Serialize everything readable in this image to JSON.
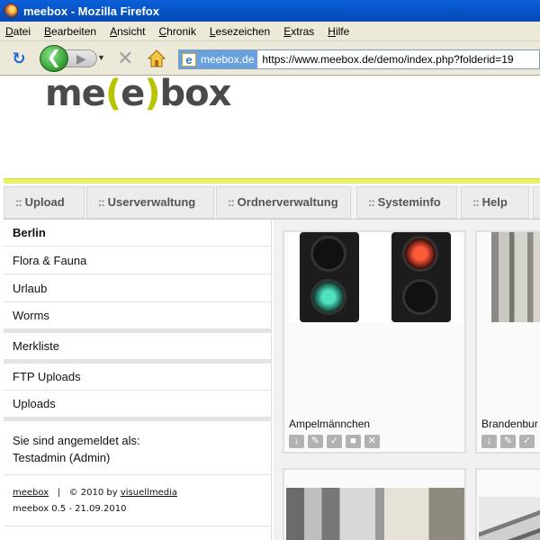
{
  "browser": {
    "title": "meebox - Mozilla Firefox",
    "menu": [
      "Datei",
      "Bearbeiten",
      "Ansicht",
      "Chronik",
      "Lesezeichen",
      "Extras",
      "Hilfe"
    ],
    "site_identity": "meebox.de",
    "url": "https://www.meebox.de/demo/index.php?folderid=19",
    "site_identity_icon": "e"
  },
  "logo": {
    "part1": "me",
    "bracket_open": "(",
    "part2": "e",
    "bracket_close": ")",
    "part3": "box"
  },
  "tabs": [
    {
      "label": "Upload"
    },
    {
      "label": "Userverwaltung"
    },
    {
      "label": "Ordnerverwaltung"
    },
    {
      "label": "Systeminfo"
    },
    {
      "label": "Help"
    }
  ],
  "tab_prefix": "::",
  "sidebar": {
    "folders": [
      "Berlin",
      "Flora & Fauna",
      "Urlaub",
      "Worms"
    ],
    "active_folder": "Berlin",
    "merkliste": "Merkliste",
    "uploads": [
      "FTP Uploads",
      "Uploads"
    ],
    "logged_in_label": "Sie sind angemeldet als:",
    "logged_in_user": "Testadmin (Admin)",
    "footer_brand": "meebox",
    "footer_sep": "|",
    "footer_copy": "© 2010 by",
    "footer_company": "visuellmedia",
    "version": "meebox 0.5 - 21.09.2010"
  },
  "gallery": [
    {
      "title": "Ampelmännchen",
      "actions": [
        "download-icon",
        "edit-icon",
        "check-icon",
        "lock-icon",
        "delete-icon"
      ]
    },
    {
      "title": "Brandenbur",
      "actions": [
        "download-icon",
        "edit-icon",
        "check-icon"
      ]
    }
  ],
  "colors": {
    "accent": "#b8c400",
    "header_line": "#e9f06a",
    "titlebar": "#0a5fd8"
  }
}
